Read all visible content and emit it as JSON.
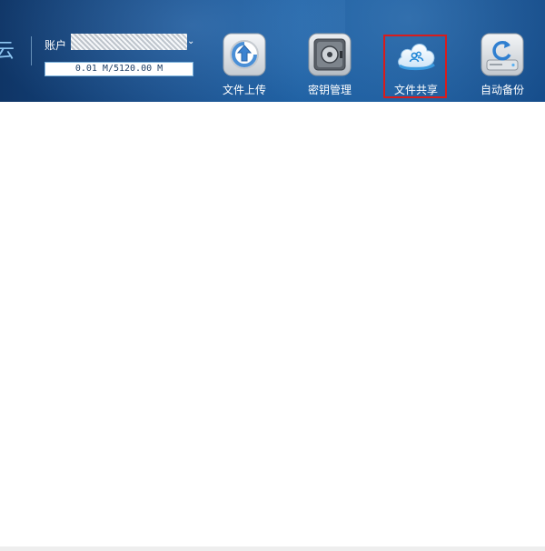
{
  "header": {
    "logo_text": "云",
    "account_label": "账户",
    "account_dropdown_glyph": "⌄",
    "storage": {
      "text": "0.01 M/5120.00 M",
      "used_fraction": 2e-06
    }
  },
  "toolbar": {
    "items": [
      {
        "label": "文件上传",
        "icon": "upload-icon"
      },
      {
        "label": "密钥管理",
        "icon": "safe-icon"
      },
      {
        "label": "文件共享",
        "icon": "cloud-share-icon",
        "highlighted": true
      },
      {
        "label": "自动备份",
        "icon": "backup-drive-icon"
      }
    ]
  },
  "colors": {
    "header_dark": "#0f3566",
    "header_light": "#1b5da0",
    "highlight_border": "#d81c1c",
    "storage_fill": "#2a9be0"
  }
}
